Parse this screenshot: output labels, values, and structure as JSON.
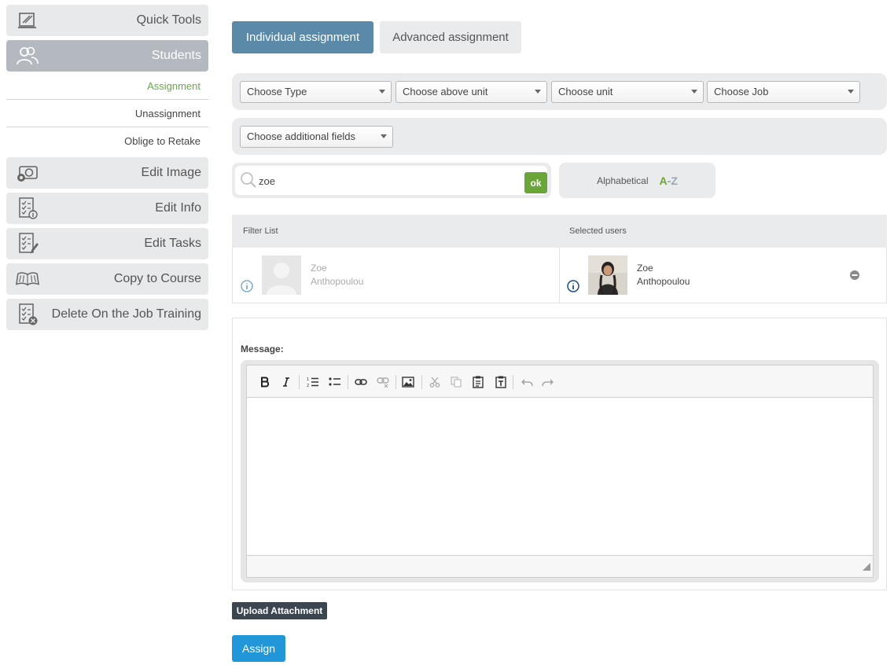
{
  "sidebar": {
    "quick_tools": "Quick Tools",
    "students": "Students",
    "sub_items": [
      "Assignment",
      "Unassignment",
      "Oblige to Retake"
    ],
    "edit_image": "Edit Image",
    "edit_info": "Edit Info",
    "edit_tasks": "Edit Tasks",
    "copy_to_course": "Copy to Course",
    "delete_otj": "Delete On the Job Training"
  },
  "tabs": {
    "individual": "Individual assignment",
    "advanced": "Advanced assignment"
  },
  "filters": {
    "type": "Choose Type",
    "above_unit": "Choose above unit",
    "unit": "Choose unit",
    "job": "Choose Job",
    "additional": "Choose additional fields"
  },
  "search": {
    "value": "zoe",
    "ok_label": "ok",
    "sort_label": "Alphabetical",
    "sort_a": "A",
    "sort_dash": "-",
    "sort_z": "Z"
  },
  "lists": {
    "filter_header": "Filter List",
    "selected_header": "Selected users",
    "filter_user": {
      "first": "Zoe",
      "last": "Anthopoulou"
    },
    "selected_user": {
      "first": "Zoe",
      "last": "Anthopoulou"
    }
  },
  "message": {
    "label": "Message:"
  },
  "actions": {
    "upload": "Upload Attachment",
    "assign": "Assign"
  },
  "colors": {
    "active_tab": "#5a8aa8",
    "accent_green": "#6aa538",
    "assign_blue": "#2196d8"
  }
}
